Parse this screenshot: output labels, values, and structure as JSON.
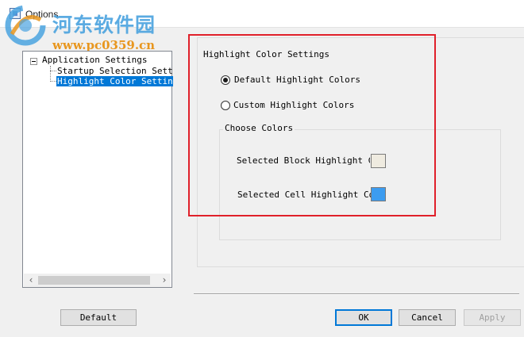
{
  "window": {
    "title": "Options"
  },
  "watermark": {
    "cn_text": "河东软件园",
    "url": "www.pc0359.cn"
  },
  "tree": {
    "root": {
      "label": "Application Settings",
      "expanded": true
    },
    "children": [
      {
        "label": "Startup Selection Settin",
        "selected": false
      },
      {
        "label": "Highlight Color Settings",
        "selected": true
      }
    ]
  },
  "panel": {
    "group_title": "Highlight Color Settings",
    "radio_options": [
      {
        "label": "Default Highlight Colors",
        "checked": true
      },
      {
        "label": "Custom Highlight Colors",
        "checked": false
      }
    ],
    "choose_colors": {
      "title": "Choose Colors",
      "block_label": "Selected Block Highlight Col",
      "block_color": "#efebe0",
      "cell_label": "Selected Cell Highlight Colo",
      "cell_color": "#3c9cf0"
    }
  },
  "buttons": {
    "default": "Default",
    "ok": "OK",
    "cancel": "Cancel",
    "apply": "Apply"
  },
  "colors": {
    "selection": "#0078d7",
    "highlight_frame": "#e0202a"
  }
}
